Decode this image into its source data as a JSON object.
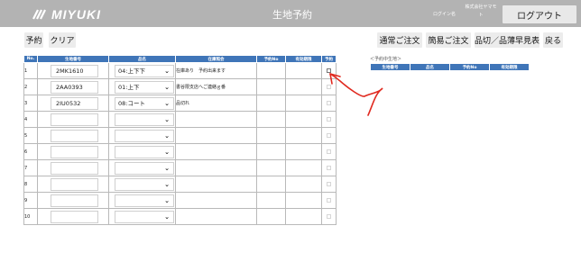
{
  "header": {
    "logo_text": "MIYUKI",
    "title": "生地予約",
    "login_label": "ログイン名",
    "company_name": "株式会社ヤマモト",
    "logout_label": "ログアウト",
    "background_color": "#b3b3b3"
  },
  "toolbar": {
    "reserve_label": "予約",
    "clear_label": "クリア",
    "normal_order_label": "通常ご注文",
    "simple_order_label": "簡易ご注文",
    "soldout_label": "品切／品薄早見表",
    "back_label": "戻る"
  },
  "table": {
    "header_color": "#3f75b8",
    "headers": [
      "No.",
      "生地番号",
      "品名",
      "在庫照会",
      "予約No",
      "有効期限",
      "予約"
    ],
    "rows": [
      {
        "no": "1",
        "code": "2MK1610",
        "name": "04:上下下",
        "stock": "在庫あり　予約出来ます",
        "reserve_no": "",
        "expiry": "",
        "checkbox_active": true
      },
      {
        "no": "2",
        "code": "2AA0393",
        "name": "01:上下",
        "stock": "書谷限支店へご連絡ｇ番",
        "reserve_no": "",
        "expiry": "",
        "checkbox_active": false
      },
      {
        "no": "3",
        "code": "2IU0532",
        "name": "08:コート",
        "stock": "品切れ",
        "reserve_no": "",
        "expiry": "",
        "checkbox_active": false
      },
      {
        "no": "4",
        "code": "",
        "name": "",
        "stock": "",
        "reserve_no": "",
        "expiry": "",
        "checkbox_active": false
      },
      {
        "no": "5",
        "code": "",
        "name": "",
        "stock": "",
        "reserve_no": "",
        "expiry": "",
        "checkbox_active": false
      },
      {
        "no": "6",
        "code": "",
        "name": "",
        "stock": "",
        "reserve_no": "",
        "expiry": "",
        "checkbox_active": false
      },
      {
        "no": "7",
        "code": "",
        "name": "",
        "stock": "",
        "reserve_no": "",
        "expiry": "",
        "checkbox_active": false
      },
      {
        "no": "8",
        "code": "",
        "name": "",
        "stock": "",
        "reserve_no": "",
        "expiry": "",
        "checkbox_active": false
      },
      {
        "no": "9",
        "code": "",
        "name": "",
        "stock": "",
        "reserve_no": "",
        "expiry": "",
        "checkbox_active": false
      },
      {
        "no": "10",
        "code": "",
        "name": "",
        "stock": "",
        "reserve_no": "",
        "expiry": "",
        "checkbox_active": false
      }
    ]
  },
  "side_panel": {
    "label": "＜予約中生地＞",
    "headers": [
      "生地番号",
      "品名",
      "予約No",
      "有効期限"
    ]
  },
  "annotation": {
    "color": "#e0291f"
  }
}
